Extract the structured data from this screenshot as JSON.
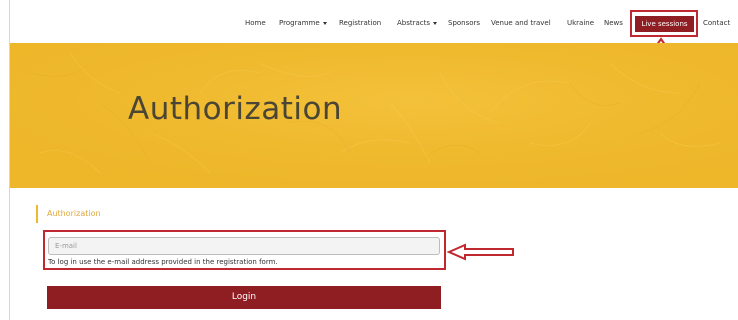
{
  "nav": {
    "items": [
      {
        "label": "Home"
      },
      {
        "label": "Programme",
        "dropdown": true
      },
      {
        "label": "Registration"
      },
      {
        "label": "Abstracts",
        "dropdown": true
      },
      {
        "label": "Sponsors"
      },
      {
        "label": "Venue and travel"
      },
      {
        "label": "Ukraine"
      },
      {
        "label": "News"
      }
    ],
    "live_sessions": "Live sessions",
    "contact": "Contact"
  },
  "hero": {
    "title": "Authorization"
  },
  "form": {
    "section_label": "Authorization",
    "email_placeholder": "E-mail",
    "email_value": "",
    "hint": "To log in use the e-mail address provided in the registration form.",
    "login_label": "Login"
  },
  "colors": {
    "accent_dark_red": "#8f1e23",
    "highlight_red": "#c0282f",
    "hero_yellow": "#f0b92c",
    "section_label": "#e1a93a"
  },
  "annotations": {
    "live_sessions_arrow": "arrow-up-icon",
    "email_arrow": "arrow-left-icon"
  }
}
